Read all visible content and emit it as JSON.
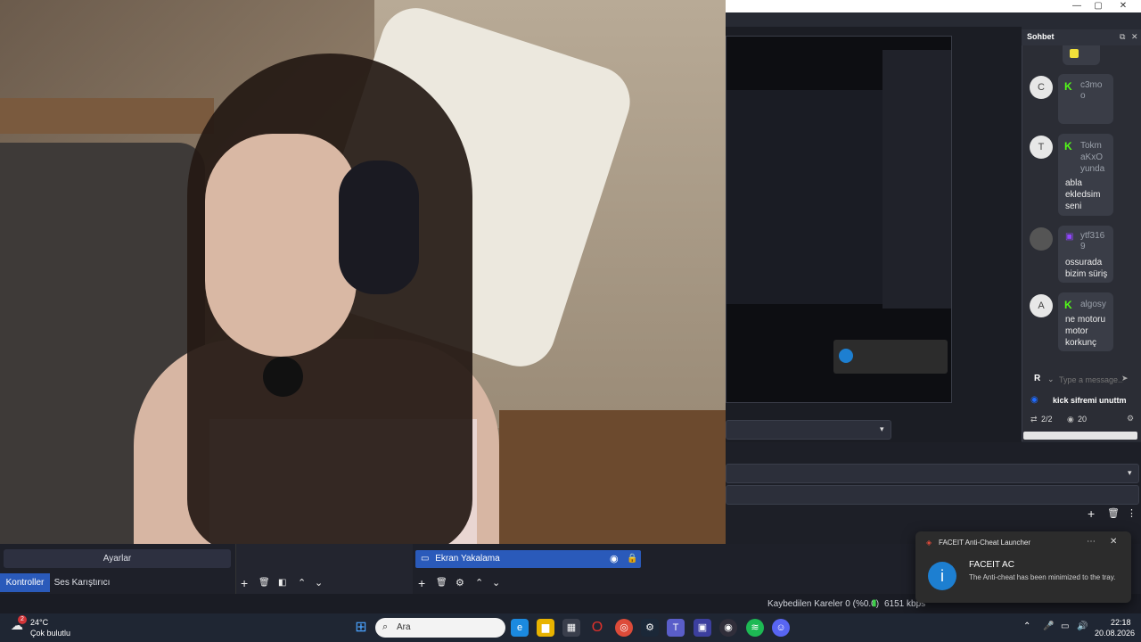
{
  "obs": {
    "chat_title": "Sohbet",
    "chat_messages": [
      {
        "initial": "C",
        "user": "c3mo o",
        "platform": "kick",
        "text": ""
      },
      {
        "initial": "T",
        "user": "Tokm aKxO yunda",
        "platform": "kick",
        "text": "abla ekledsim seni"
      },
      {
        "initial": "",
        "user": "ytf316 9",
        "platform": "twitch",
        "text": "ossurada bizim süriş"
      },
      {
        "initial": "A",
        "user": "algosy",
        "platform": "kick",
        "text": "ne motoru motor korkunç"
      }
    ],
    "chat_input_placeholder": "Type a message...",
    "chat_user_initial": "R",
    "pinned_text": "kick sifremi unuttm",
    "counter_left": "2/2",
    "viewers": "20",
    "settings_label": "Ayarlar",
    "tab_controls": "Kontroller",
    "tab_mixer": "Ses Karıştırıcı",
    "source_screen": "Ekran Yakalama",
    "dropped_frames": "Kaybedilen Kareler 0 (%0.0)",
    "bitrate": "6151 kbps"
  },
  "toast": {
    "app": "FACEIT Anti-Cheat Launcher",
    "title": "FACEIT AC",
    "body": "The Anti-cheat has been minimized to the tray."
  },
  "taskbar": {
    "weather_temp": "24°C",
    "weather_desc": "Çok bulutlu",
    "weather_badge": "2",
    "search_label": "Ara",
    "time": "22:18",
    "date": "20.08.2026"
  }
}
